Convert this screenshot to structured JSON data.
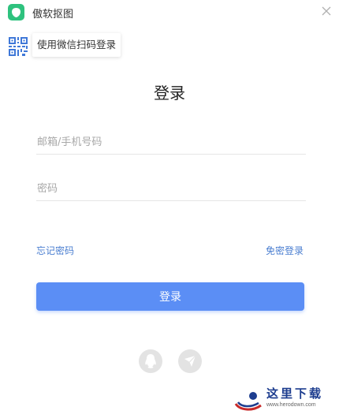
{
  "window": {
    "title": "傲软抠图",
    "close_icon": "close-icon",
    "accent": "#2ec27e"
  },
  "qr_login": {
    "icon": "qr-code-icon",
    "tip": "使用微信扫码登录"
  },
  "form": {
    "title": "登录",
    "email_placeholder": "邮箱/手机号码",
    "email_value": "",
    "password_placeholder": "密码",
    "password_value": "",
    "forgot_password": "忘记密码",
    "password_free_login": "免密登录",
    "submit": "登录",
    "button_color": "#5b8ef5",
    "link_color": "#4a7ed0"
  },
  "social": [
    {
      "icon": "qq-icon"
    },
    {
      "icon": "paper-plane-icon"
    }
  ],
  "watermark": {
    "text": "这里下载",
    "url": "www.herodown.com"
  }
}
